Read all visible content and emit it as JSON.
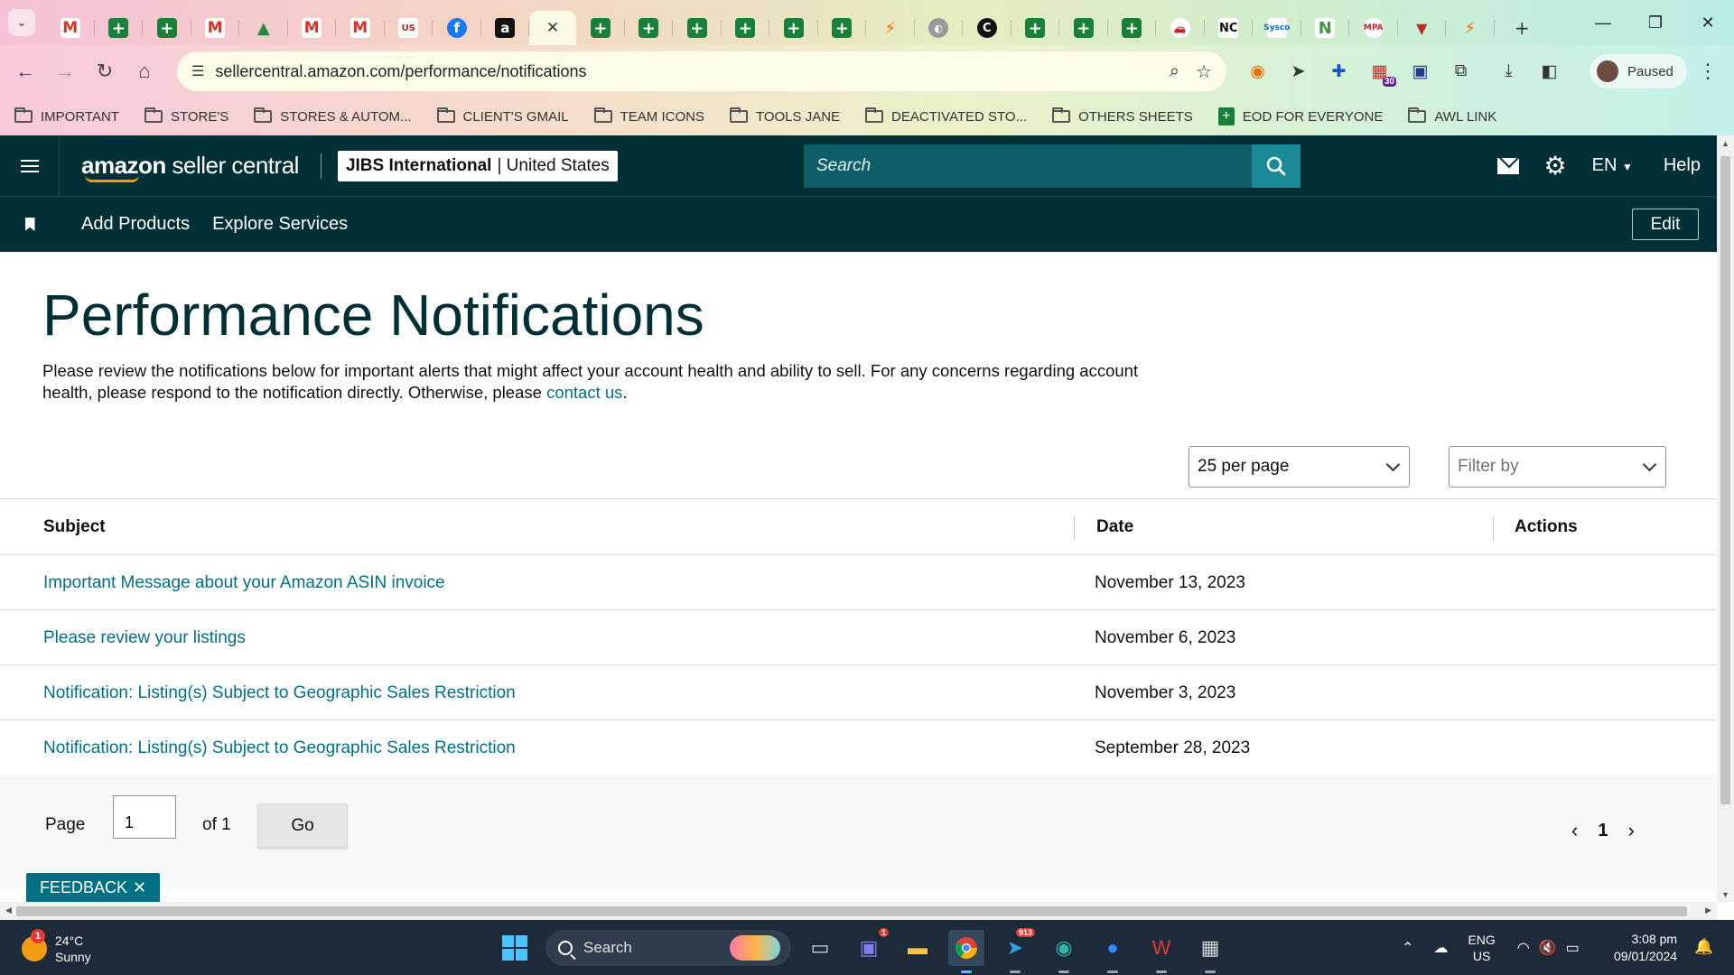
{
  "browser": {
    "tabs": [
      {
        "icon": "gmail-icon",
        "glyph": "M"
      },
      {
        "icon": "sheets-icon",
        "glyph": "+"
      },
      {
        "icon": "sheets-icon",
        "glyph": "+"
      },
      {
        "icon": "gmail-icon",
        "glyph": "M"
      },
      {
        "icon": "drive-icon",
        "glyph": "▲"
      },
      {
        "icon": "gmail-icon",
        "glyph": "M"
      },
      {
        "icon": "gmail-icon",
        "glyph": "M"
      },
      {
        "icon": "us-foods-icon",
        "glyph": "US"
      },
      {
        "icon": "facebook-icon",
        "glyph": "f"
      },
      {
        "icon": "amazon-icon",
        "glyph": "a"
      },
      {
        "icon": "close-icon",
        "glyph": "✕",
        "active": true
      },
      {
        "icon": "sheets-icon",
        "glyph": "+"
      },
      {
        "icon": "sheets-icon",
        "glyph": "+"
      },
      {
        "icon": "sheets-icon",
        "glyph": "+"
      },
      {
        "icon": "sheets-icon",
        "glyph": "+"
      },
      {
        "icon": "sheets-icon",
        "glyph": "+"
      },
      {
        "icon": "sheets-icon",
        "glyph": "+"
      },
      {
        "icon": "zapier-icon",
        "glyph": "⚡"
      },
      {
        "icon": "globe-icon",
        "glyph": "◐"
      },
      {
        "icon": "c-icon",
        "glyph": "C"
      },
      {
        "icon": "sheets-icon",
        "glyph": "+"
      },
      {
        "icon": "sheets-icon",
        "glyph": "+"
      },
      {
        "icon": "sheets-icon",
        "glyph": "+"
      },
      {
        "icon": "car-icon",
        "glyph": "🚗"
      },
      {
        "icon": "nc-icon",
        "glyph": "NC"
      },
      {
        "icon": "sysco-icon",
        "glyph": "Sysco"
      },
      {
        "icon": "n-icon",
        "glyph": "N"
      },
      {
        "icon": "mpa-icon",
        "glyph": "MPA"
      },
      {
        "icon": "v-icon",
        "glyph": "▼"
      },
      {
        "icon": "zapier-icon",
        "glyph": "⚡"
      }
    ],
    "url": "sellercentral.amazon.com/performance/notifications",
    "extension_badge": "30",
    "profile_status": "Paused",
    "bookmarks": [
      {
        "label": "IMPORTANT",
        "type": "folder"
      },
      {
        "label": "STORE'S",
        "type": "folder"
      },
      {
        "label": "STORES & AUTOM...",
        "type": "folder"
      },
      {
        "label": "CLIENT'S GMAIL",
        "type": "folder"
      },
      {
        "label": "TEAM ICONS",
        "type": "folder"
      },
      {
        "label": "TOOLS JANE",
        "type": "folder"
      },
      {
        "label": "DEACTIVATED STO...",
        "type": "folder"
      },
      {
        "label": "OTHERS SHEETS",
        "type": "folder"
      },
      {
        "label": "EOD FOR EVERYONE",
        "type": "sheet"
      },
      {
        "label": "AWL LINK",
        "type": "folder"
      }
    ]
  },
  "header": {
    "logo_bold": "amazon",
    "logo_rest": " seller central",
    "store_name": "JIBS International",
    "store_region": "| United States",
    "search_placeholder": "Search",
    "lang": "EN",
    "help": "Help"
  },
  "nav": {
    "items": [
      "Add Products",
      "Explore Services"
    ],
    "edit": "Edit"
  },
  "main": {
    "title": "Performance Notifications",
    "intro_text": "Please review the notifications below for important alerts that might affect your account health and ability to sell. For any concerns regarding account health, please respond to the notification directly. Otherwise, please ",
    "intro_link": "contact us",
    "intro_end": ".",
    "per_page": "25 per page",
    "filter_placeholder": "Filter by",
    "columns": {
      "subject": "Subject",
      "date": "Date",
      "actions": "Actions"
    },
    "rows": [
      {
        "subject": "Important Message about your Amazon ASIN invoice",
        "date": "November 13, 2023"
      },
      {
        "subject": "Please review your listings",
        "date": "November 6, 2023"
      },
      {
        "subject": "Notification: Listing(s) Subject to Geographic Sales Restriction",
        "date": "November 3, 2023"
      },
      {
        "subject": "Notification: Listing(s) Subject to Geographic Sales Restriction",
        "date": "September 28, 2023"
      }
    ],
    "pagination": {
      "page_label": "Page",
      "page_value": "1",
      "of_label": "of 1",
      "go": "Go",
      "current": "1"
    },
    "feedback": "FEEDBACK"
  },
  "taskbar": {
    "weather_temp": "24°C",
    "weather_desc": "Sunny",
    "weather_badge": "1",
    "search_label": "Search",
    "teams_badge": "1",
    "telegram_badge": "913",
    "lang_line1": "ENG",
    "lang_line2": "US",
    "time": "3:08 pm",
    "date": "09/01/2024"
  },
  "colors": {
    "nav_bg": "#002f36",
    "link": "#007185",
    "search_bg": "#0e5d68",
    "search_btn": "#1a8a96"
  }
}
